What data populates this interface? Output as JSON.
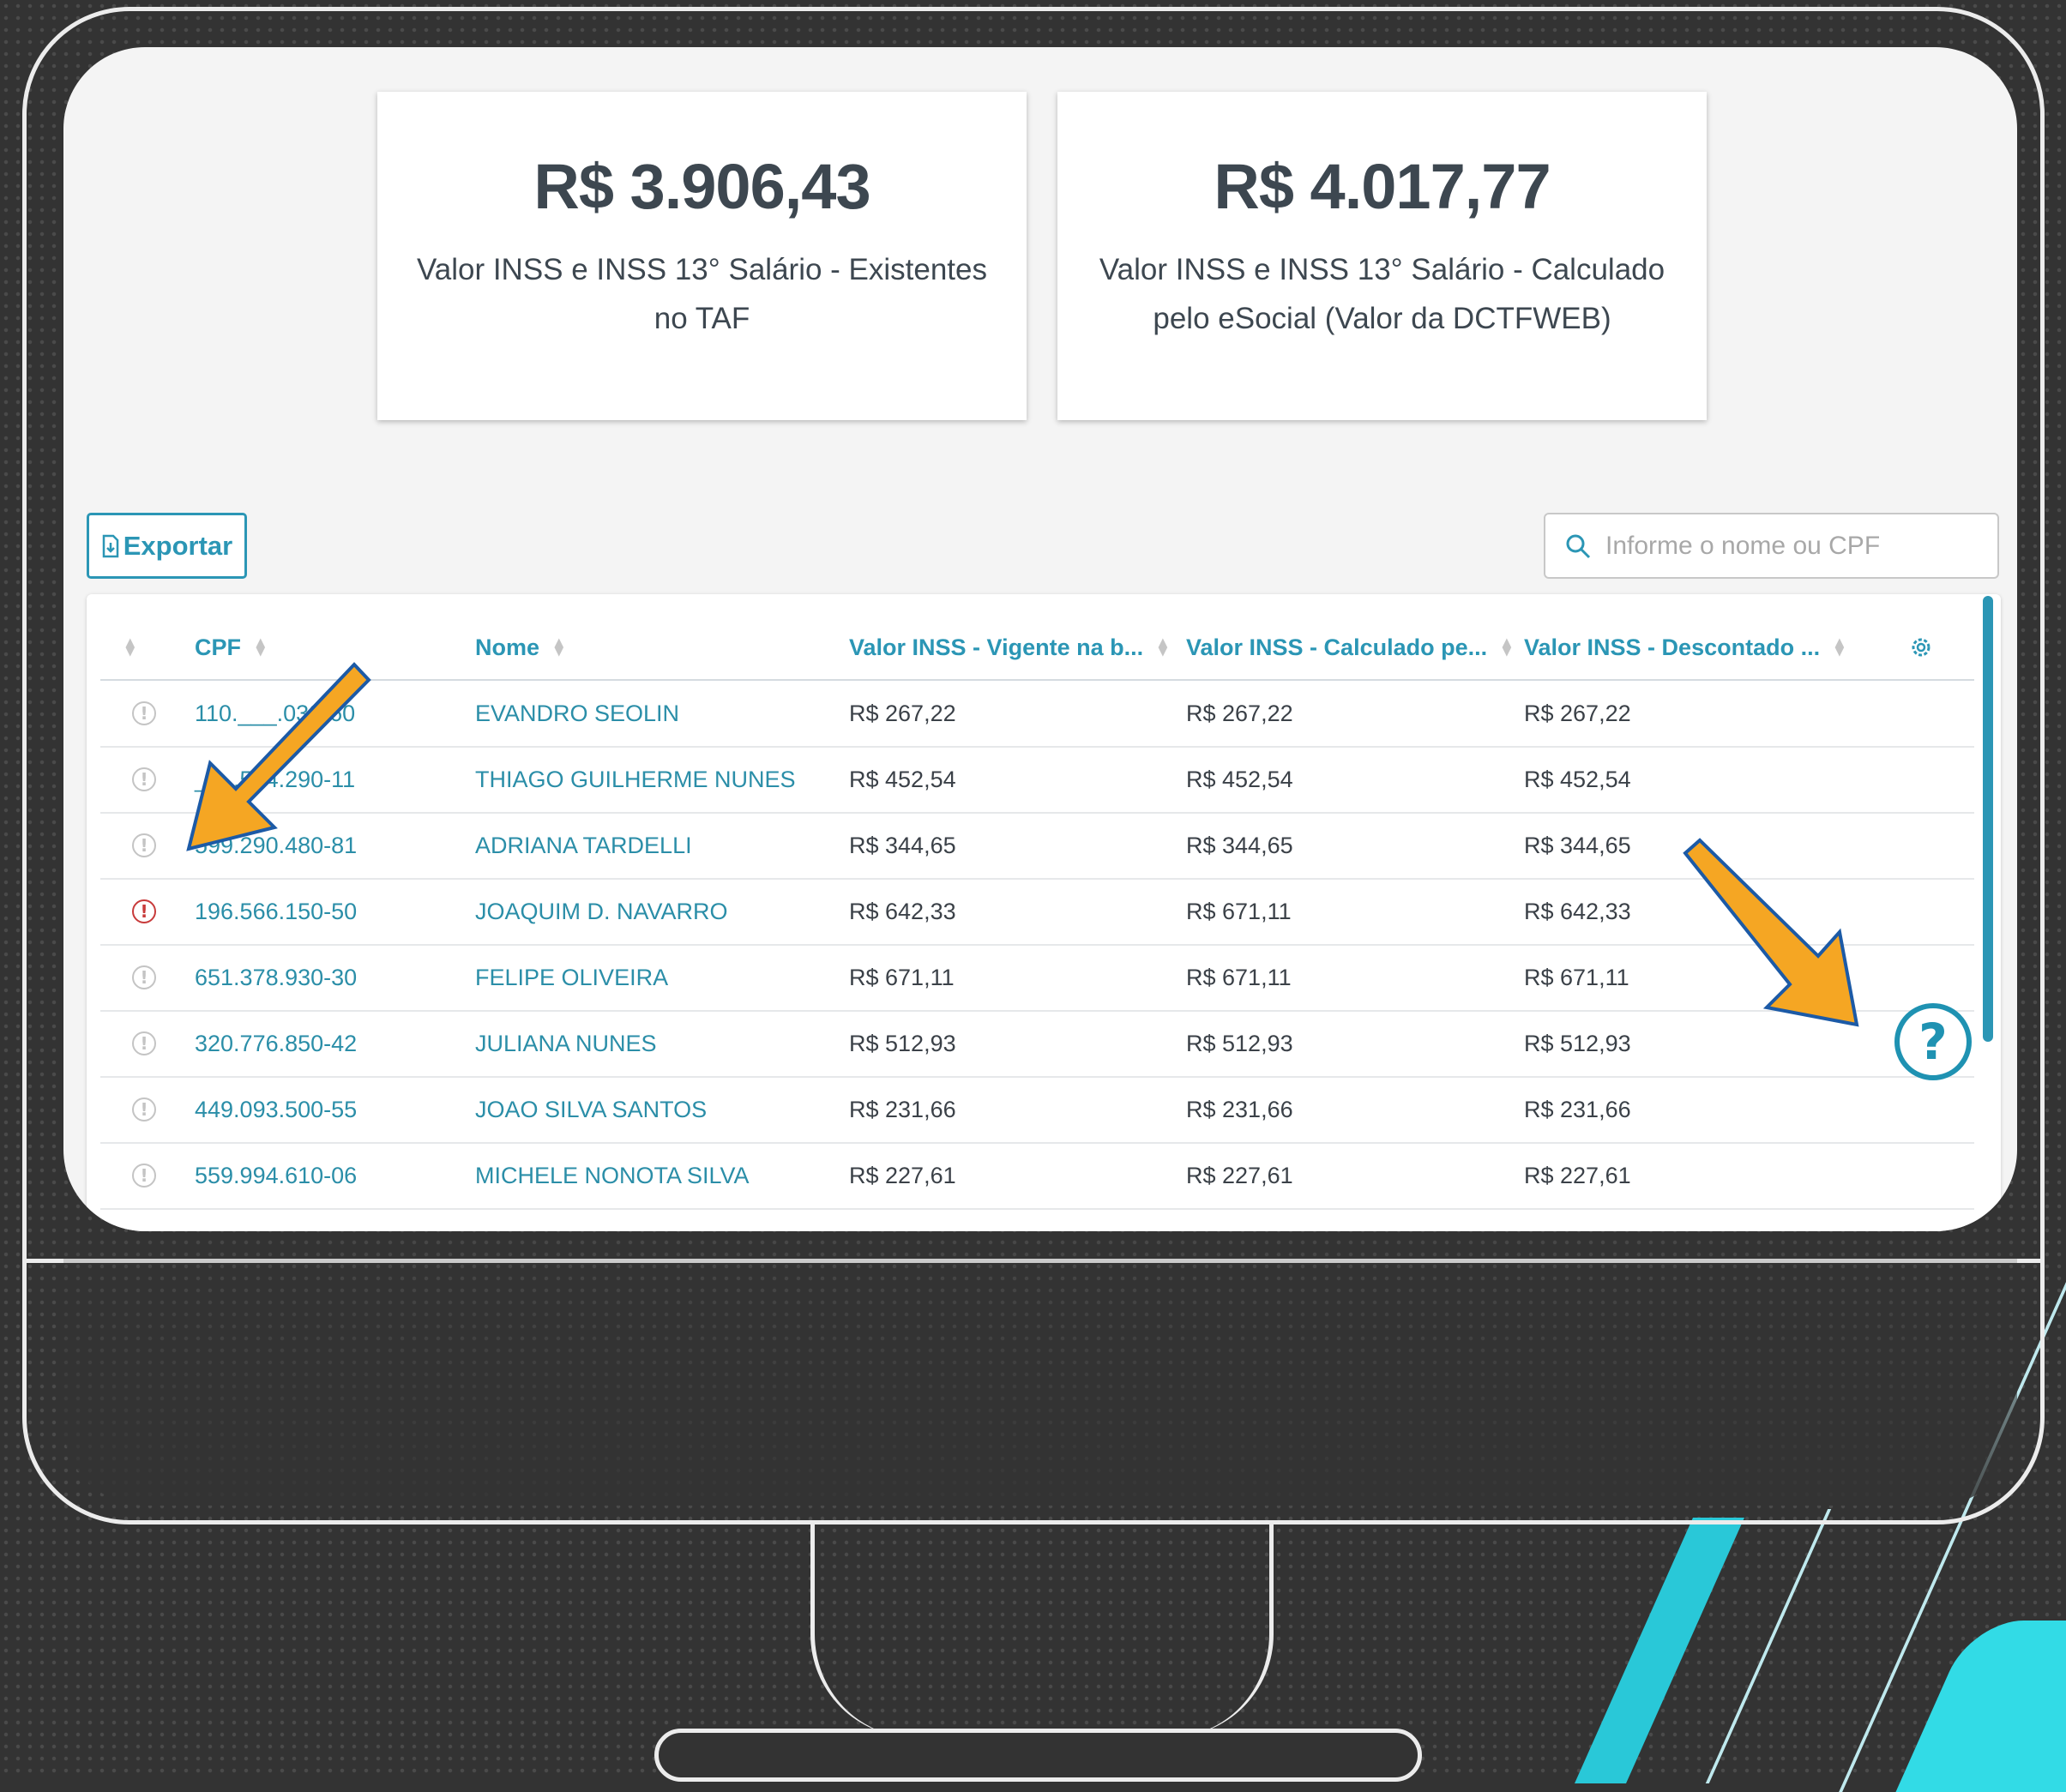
{
  "summary_cards": [
    {
      "value": "R$ 3.906,43",
      "label": "Valor INSS e INSS 13° Salário - Existentes no TAF"
    },
    {
      "value": "R$ 4.017,77",
      "label": "Valor INSS e INSS 13° Salário - Calculado pelo eSocial (Valor da DCTFWEB)"
    }
  ],
  "toolbar": {
    "export_label": "Exportar",
    "export_icon": "file-export-icon",
    "search_placeholder": "Informe o nome ou CPF",
    "search_icon": "search-icon"
  },
  "table": {
    "columns": [
      "CPF",
      "Nome",
      "Valor INSS - Vigente na b...",
      "Valor INSS - Calculado pe...",
      "Valor INSS - Descontado ..."
    ],
    "settings_icon": "gear-icon",
    "rows": [
      {
        "status": "info",
        "cpf": "110.___.030-60",
        "nome": "EVANDRO SEOLIN",
        "vigente": "R$ 267,22",
        "calculado": "R$ 267,22",
        "descontado": "R$ 267,22"
      },
      {
        "status": "info",
        "cpf": "___.564.290-11",
        "nome": "THIAGO GUILHERME NUNES",
        "vigente": "R$ 452,54",
        "calculado": "R$ 452,54",
        "descontado": "R$ 452,54"
      },
      {
        "status": "info",
        "cpf": "599.290.480-81",
        "nome": "ADRIANA TARDELLI",
        "vigente": "R$ 344,65",
        "calculado": "R$ 344,65",
        "descontado": "R$ 344,65"
      },
      {
        "status": "error",
        "cpf": "196.566.150-50",
        "nome": "JOAQUIM D. NAVARRO",
        "vigente": "R$ 642,33",
        "calculado": "R$ 671,11",
        "descontado": "R$ 642,33"
      },
      {
        "status": "info",
        "cpf": "651.378.930-30",
        "nome": "FELIPE OLIVEIRA",
        "vigente": "R$ 671,11",
        "calculado": "R$ 671,11",
        "descontado": "R$ 671,11"
      },
      {
        "status": "info",
        "cpf": "320.776.850-42",
        "nome": "JULIANA NUNES",
        "vigente": "R$ 512,93",
        "calculado": "R$ 512,93",
        "descontado": "R$ 512,93"
      },
      {
        "status": "info",
        "cpf": "449.093.500-55",
        "nome": "JOAO SILVA SANTOS",
        "vigente": "R$ 231,66",
        "calculado": "R$ 231,66",
        "descontado": "R$ 231,66"
      },
      {
        "status": "info",
        "cpf": "559.994.610-06",
        "nome": "MICHELE NONOTA SILVA",
        "vigente": "R$ 227,61",
        "calculado": "R$ 227,61",
        "descontado": "R$ 227,61"
      }
    ]
  },
  "help_button": {
    "icon": "question-circle-icon"
  },
  "annotations": {
    "arrow_color": "#f5a623",
    "arrow_icons": [
      "arrow-down-left-icon",
      "arrow-down-right-icon"
    ]
  },
  "colors": {
    "accent": "#2b96b5",
    "error": "#c83b3b",
    "background": "#333333",
    "decor": "#29c8d8"
  }
}
